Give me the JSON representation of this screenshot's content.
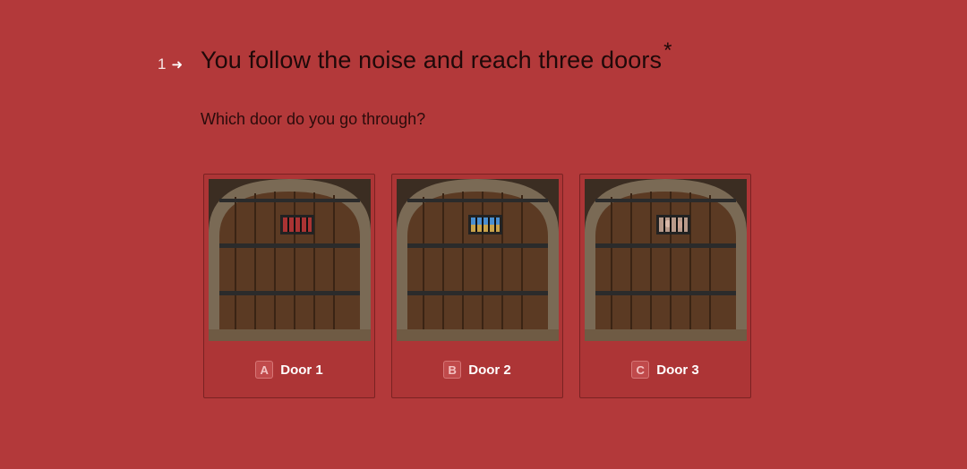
{
  "question": {
    "number": "1",
    "arrow": "➜",
    "title": "You follow the noise and reach three doors",
    "required_mark": "*",
    "description": "Which door do you go through?"
  },
  "choices": [
    {
      "key": "A",
      "label": "Door 1"
    },
    {
      "key": "B",
      "label": "Door 2"
    },
    {
      "key": "C",
      "label": "Door 3"
    }
  ],
  "colors": {
    "background": "#b3393a",
    "title": "#1f0909",
    "choice_text": "#ffffff"
  }
}
